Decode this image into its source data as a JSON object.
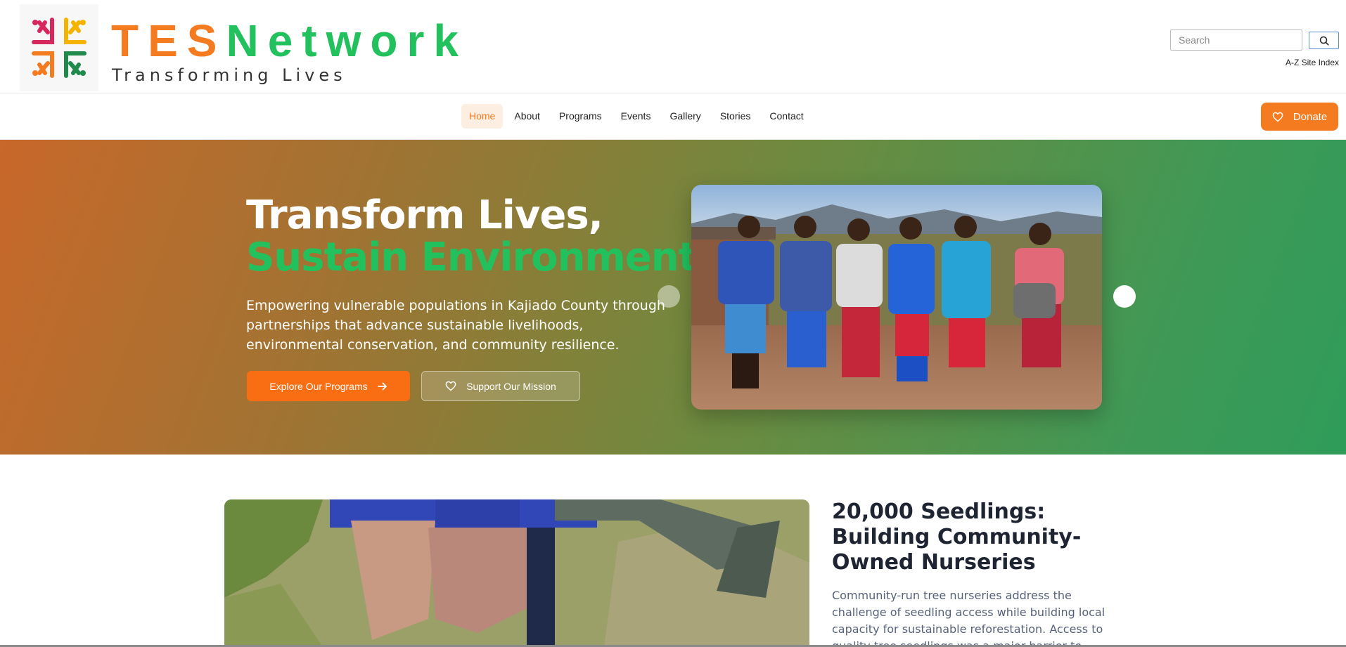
{
  "brand": {
    "part1": "TES",
    "part2": "Network",
    "tagline": "Transforming Lives"
  },
  "header": {
    "search_placeholder": "Search",
    "az_index": "A-Z Site Index",
    "search_icon": "search-icon"
  },
  "nav": {
    "items": [
      "Home",
      "About",
      "Programs",
      "Events",
      "Gallery",
      "Stories",
      "Contact"
    ],
    "active": "Home",
    "donate_label": "Donate",
    "donate_icon": "heart-icon"
  },
  "hero": {
    "title_line1": "Transform Lives,",
    "title_line2": "Sustain Environment",
    "description": "Empowering vulnerable populations in Kajiado County through partnerships that advance sustainable livelihoods, environmental conservation, and community resilience.",
    "primary_button": "Explore Our Programs",
    "primary_icon": "arrow-right-icon",
    "secondary_button": "Support Our Mission",
    "secondary_icon": "heart-icon"
  },
  "story": {
    "title": "20,000 Seedlings: Building Community-Owned Nurseries",
    "text": "Community-run tree nurseries address the challenge of seedling access while building local capacity for sustainable reforestation. Access to quality tree seedlings was a major barrier to reforestation efforts. By establishing"
  },
  "colors": {
    "orange": "#f47b20",
    "green": "#22c15e",
    "dark_text": "#1e2431"
  }
}
